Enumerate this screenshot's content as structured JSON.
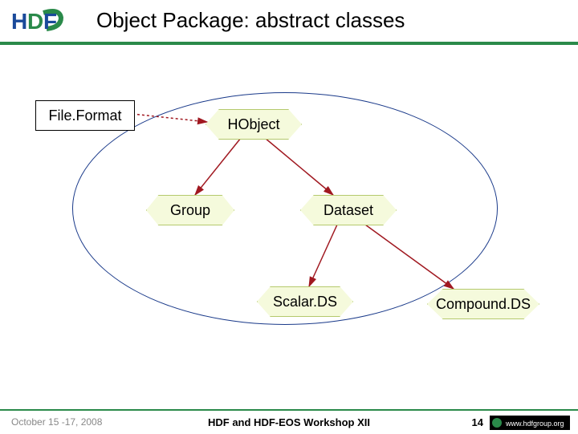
{
  "header": {
    "title": "Object Package: abstract classes",
    "logo_text": "HDF"
  },
  "nodes": {
    "fileformat": "File.Format",
    "hobject": "HObject",
    "group": "Group",
    "dataset": "Dataset",
    "scalards": "Scalar.DS",
    "compoundds": "Compound.DS"
  },
  "footer": {
    "date": "October 15 -17, 2008",
    "center": "HDF and HDF-EOS Workshop XII",
    "page": "14",
    "org": "www.hdfgroup.org"
  },
  "chart_data": {
    "type": "diagram",
    "title": "Object Package: abstract classes",
    "nodes": [
      {
        "id": "FileFormat",
        "label": "File.Format",
        "kind": "external"
      },
      {
        "id": "HObject",
        "label": "HObject",
        "kind": "abstract"
      },
      {
        "id": "Group",
        "label": "Group",
        "kind": "abstract"
      },
      {
        "id": "Dataset",
        "label": "Dataset",
        "kind": "abstract"
      },
      {
        "id": "ScalarDS",
        "label": "Scalar.DS",
        "kind": "abstract"
      },
      {
        "id": "CompoundDS",
        "label": "Compound.DS",
        "kind": "abstract"
      }
    ],
    "edges": [
      {
        "from": "FileFormat",
        "to": "HObject",
        "style": "dotted"
      },
      {
        "from": "HObject",
        "to": "Group",
        "style": "solid"
      },
      {
        "from": "HObject",
        "to": "Dataset",
        "style": "solid"
      },
      {
        "from": "Dataset",
        "to": "ScalarDS",
        "style": "solid"
      },
      {
        "from": "Dataset",
        "to": "CompoundDS",
        "style": "solid"
      }
    ],
    "grouping": {
      "ellipse_contains": [
        "HObject",
        "Group",
        "Dataset",
        "ScalarDS"
      ]
    }
  }
}
